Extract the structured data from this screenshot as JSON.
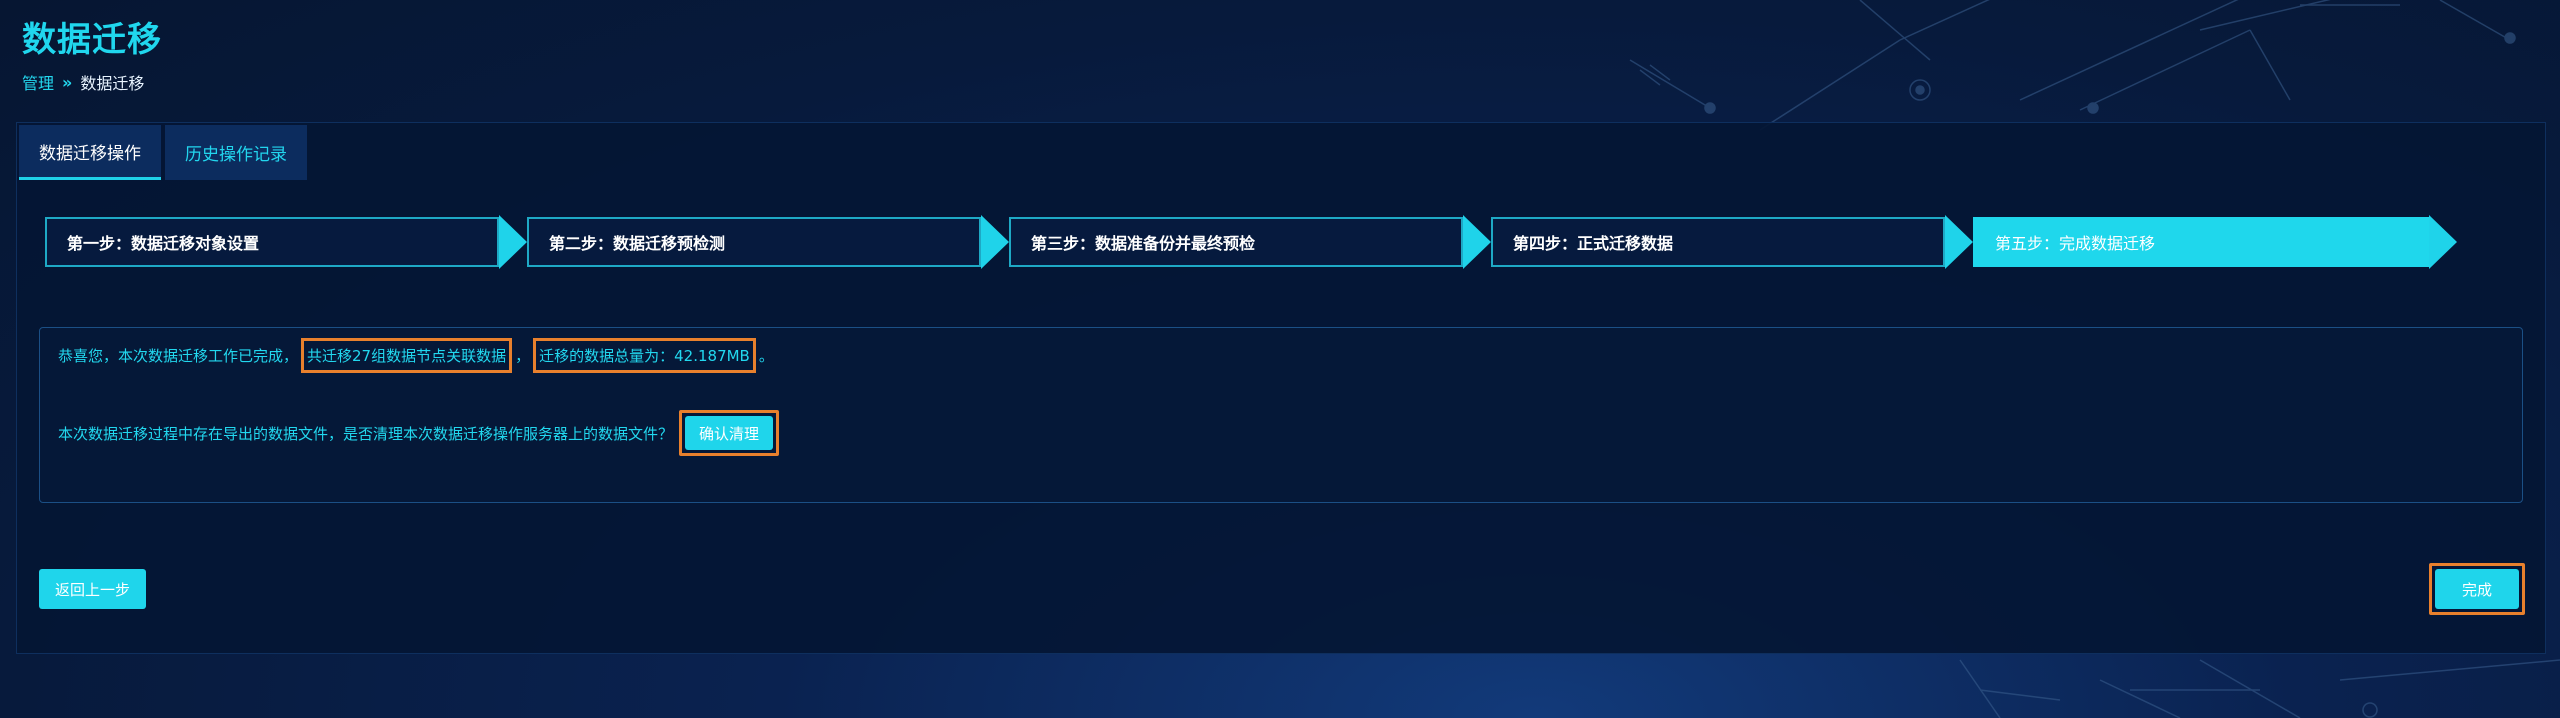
{
  "header": {
    "title": "数据迁移",
    "breadcrumb": {
      "parent": "管理",
      "separator": "»",
      "current": "数据迁移"
    }
  },
  "tabs": [
    {
      "label": "数据迁移操作",
      "active": true
    },
    {
      "label": "历史操作记录",
      "active": false
    }
  ],
  "steps": [
    {
      "label": "第一步：数据迁移对象设置",
      "done": false
    },
    {
      "label": "第二步：数据迁移预检测",
      "done": false
    },
    {
      "label": "第三步：数据准备份并最终预检",
      "done": false
    },
    {
      "label": "第四步：正式迁移数据",
      "done": false
    },
    {
      "label": "第五步：完成数据迁移",
      "done": true
    }
  ],
  "result": {
    "prefix": "恭喜您，本次数据迁移工作已完成，",
    "nodes_text": "共迁移27组数据节点关联数据",
    "comma": "，",
    "size_text": "迁移的数据总量为：42.187MB",
    "suffix": "。",
    "cleanup_question": "本次数据迁移过程中存在导出的数据文件，是否清理本次数据迁移操作服务器上的数据文件？",
    "cleanup_button": "确认清理"
  },
  "actions": {
    "back_label": "返回上一步",
    "finish_label": "完成"
  },
  "colors": {
    "accent": "#1fd5eb",
    "highlight_border": "#e8802d",
    "panel_bg": "#04163a"
  }
}
